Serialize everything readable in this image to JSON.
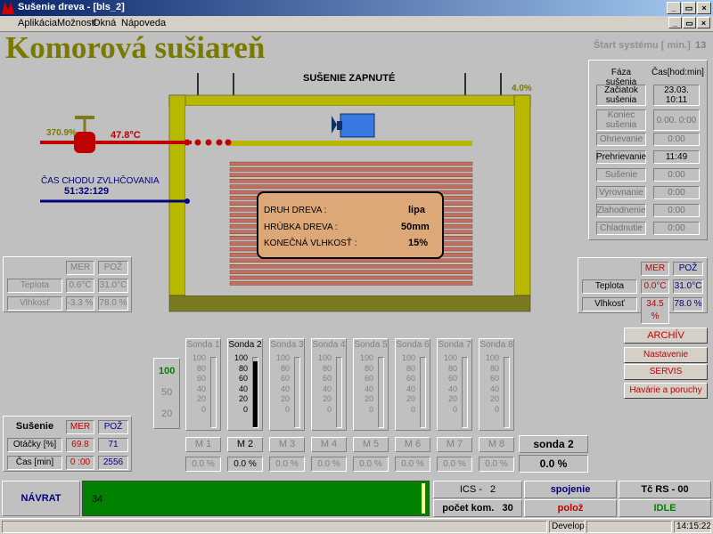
{
  "window": {
    "title": "Sušenie dreva - [bls_2]"
  },
  "menu": [
    "Aplikácia",
    "Možnosti",
    "Okná",
    "Nápoveda"
  ],
  "header": {
    "title": "Komorová sušiareň",
    "start_label": "Štart systému [ min.]",
    "start_value": "13"
  },
  "kiln": {
    "status": "SUŠENIE ZAPNUTÉ",
    "vent_right_pct": "4.0%",
    "valve_pct": "370.9%",
    "steam_temp": "47.8°C",
    "humidifier_label": "ČAS CHODU ZVLHČOVANIA",
    "humidifier_time": "51:32:129"
  },
  "wood": {
    "labels": [
      "DRUH DREVA :",
      "HRÚBKA DREVA :",
      "KONEČNÁ VLHKOSŤ :"
    ],
    "values": [
      "lipa",
      "50mm",
      "15%"
    ]
  },
  "phases": {
    "col1": "Fáza sušenia",
    "col2": "Čas[hod:min]",
    "rows": [
      {
        "label": "Začiatok sušenia",
        "value": "23.03. 10:11"
      },
      {
        "label": "Koniec sušenia",
        "value": "0.00. 0:00"
      },
      {
        "label": "Ohrievanie",
        "value": "0:00"
      },
      {
        "label": "Prehrievanie",
        "value": "11:49"
      },
      {
        "label": "Sušenie",
        "value": "0:00"
      },
      {
        "label": "Vyrovnanie",
        "value": "0:00"
      },
      {
        "label": "Zlahodnenie",
        "value": "0:00"
      },
      {
        "label": "Chladnutie",
        "value": "0:00"
      }
    ]
  },
  "left_table": {
    "mer": "MER",
    "poz": "POŽ",
    "rows": [
      {
        "label": "Teplota",
        "mer": "0.6°C",
        "poz": "31.0°C"
      },
      {
        "label": "Vlhkosť",
        "mer": "-3.3 %",
        "poz": "78.0 %"
      }
    ]
  },
  "right_table": {
    "mer": "MER",
    "poz": "POŽ",
    "rows": [
      {
        "label": "Teplota",
        "mer": "0.0°C",
        "poz": "31.0°C"
      },
      {
        "label": "Vlhkosť",
        "mer": "34.5 %",
        "poz": "78.0 %"
      }
    ]
  },
  "drying": {
    "title": "Sušenie",
    "mer": "MER",
    "poz": "POŽ",
    "rows": [
      {
        "label": "Otáčky [%]",
        "mer": "69.8",
        "poz": "71"
      },
      {
        "label": "Čas [min]",
        "mer": "0 :00",
        "poz": "2556"
      }
    ]
  },
  "scale": [
    "100",
    "50",
    "20"
  ],
  "probes": {
    "ticks": [
      "100",
      "80",
      "60",
      "40",
      "20",
      "0"
    ],
    "items": [
      {
        "name": "Sonda 1",
        "m": "M 1",
        "pct": "0.0 %",
        "fill": 0
      },
      {
        "name": "Sonda 2",
        "m": "M 2",
        "pct": "0.0 %",
        "fill": 0.95
      },
      {
        "name": "Sonda 3",
        "m": "M 3",
        "pct": "0.0 %",
        "fill": 0
      },
      {
        "name": "Sonda 4",
        "m": "M 4",
        "pct": "0.0 %",
        "fill": 0
      },
      {
        "name": "Sonda 5",
        "m": "M 5",
        "pct": "0.0 %",
        "fill": 0
      },
      {
        "name": "Sonda 6",
        "m": "M 6",
        "pct": "0.0 %",
        "fill": 0
      },
      {
        "name": "Sonda 7",
        "m": "M 7",
        "pct": "0.0 %",
        "fill": 0
      },
      {
        "name": "Sonda 8",
        "m": "M 8",
        "pct": "0.0 %",
        "fill": 0
      }
    ],
    "selected_name": "sonda 2",
    "selected_value": "0.0 %"
  },
  "buttons": {
    "archiv": "ARCHÍV",
    "params": "Nastavenie parametrov",
    "servis": "SERVIS",
    "havarie": "Havárie a poruchy",
    "navrat": "NÁVRAT"
  },
  "bottom": {
    "progress_value": "34",
    "ics_label": "ICS -",
    "ics_value": "2",
    "count_label": "počet kom.",
    "count_value": "30",
    "spojenie": "spojenie",
    "poloz": "polož",
    "rs_label": "Tč RS - 00",
    "idle": "IDLE"
  },
  "statusbar": {
    "mode": "Develop",
    "time": "14:15:22"
  },
  "colors": {
    "title_olive": "#7a7a00",
    "kiln_wall": "#b8b800",
    "stack": "#c07060",
    "panel": "#dca878",
    "navy": "#000080",
    "red": "#c00000",
    "progress_green": "#008000"
  }
}
